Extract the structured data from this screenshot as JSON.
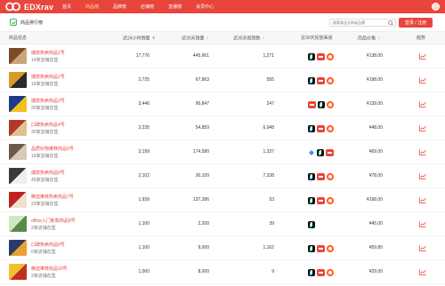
{
  "app": {
    "logo_text": "EDXrav",
    "nav": [
      "首页",
      "商品榜",
      "品牌榜",
      "店铺榜",
      "直播榜",
      "会员中心"
    ],
    "nav_active_index": 1
  },
  "subheader": {
    "title": "商品排行榜",
    "search_placeholder": "搜索商品名称或品牌",
    "cta_label": "登录 / 注册"
  },
  "table": {
    "columns": [
      {
        "label": "商品信息"
      },
      {
        "label": "近24小时销量",
        "sort": "▼"
      },
      {
        "label": "近30天销量",
        "sort": "⇕"
      },
      {
        "label": "近30天视频数",
        "sort": "⇕"
      },
      {
        "label": "近30天投放渠道"
      },
      {
        "label": "商品价格",
        "sort": "⇕"
      },
      {
        "label": "趋势"
      }
    ],
    "rows": [
      {
        "name": "爆款热卖商品1号",
        "shops": "14家店铺在售",
        "sales24": "17,776",
        "sales30": "445,961",
        "videos": "1,271",
        "platforms": [
          "dy",
          "tb",
          "ks"
        ],
        "price": "¥138.00",
        "thumb": [
          "#7a4a2a",
          "#c8a57a"
        ]
      },
      {
        "name": "爆款热卖商品2号",
        "shops": "16家店铺在售",
        "sales24": "2,725",
        "sales30": "67,863",
        "videos": "555",
        "platforms": [
          "dy",
          "tb",
          "ks"
        ],
        "price": "¥198.00",
        "thumb": [
          "#d89a2a",
          "#2a2a2a"
        ]
      },
      {
        "name": "爆款热卖商品3号",
        "shops": "20家店铺在售",
        "sales24": "3,446",
        "sales30": "90,847",
        "videos": "247",
        "platforms": [
          "tb",
          "dy",
          "ks"
        ],
        "price": "¥139.00",
        "thumb": [
          "#1c3a8a",
          "#f0c020"
        ]
      },
      {
        "name": "口碑热卖商品4号",
        "shops": "30家店铺在售",
        "sales24": "3,235",
        "sales30": "54,859",
        "videos": "6,948",
        "platforms": [
          "dy",
          "tb",
          "ks"
        ],
        "price": "¥48.00",
        "thumb": [
          "#b03a2a",
          "#e0c090"
        ]
      },
      {
        "name": "品质好物推荐商品5号",
        "shops": "16家店铺在售",
        "sales24": "3,199",
        "sales30": "174,580",
        "videos": "1,337",
        "platforms": [
          "pdd",
          "dy",
          "tb"
        ],
        "price": "¥69.00",
        "thumb": [
          "#6a5a4a",
          "#d8c8b8"
        ]
      },
      {
        "name": "爆款热卖商品6号",
        "shops": "45家店铺在售",
        "sales24": "2,102",
        "sales30": "30,109",
        "videos": "7,338",
        "platforms": [
          "dy",
          "tb",
          "ks"
        ],
        "price": "¥78.00",
        "thumb": [
          "#3a3a3a",
          "#eeeeee"
        ]
      },
      {
        "name": "精选推荐热卖商品7号",
        "shops": "23家店铺在售",
        "sales24": "1,939",
        "sales30": "137,286",
        "videos": "53",
        "platforms": [
          "dy",
          "tb",
          "ks"
        ],
        "price": "¥168.00",
        "thumb": [
          "#c02020",
          "#f0e0d0"
        ]
      },
      {
        "name": "office入门新款商品8号",
        "shops": "2家店铺在售",
        "sales24": "1,100",
        "sales30": "2,200",
        "videos": "39",
        "platforms": [
          "dy"
        ],
        "price": "¥45.00",
        "thumb": [
          "#d0e8c0",
          "#5a8a4a"
        ]
      },
      {
        "name": "口碑热卖商品9号",
        "shops": "6家店铺在售",
        "sales24": "1,100",
        "sales30": "9,000",
        "videos": "1,162",
        "platforms": [
          "dy",
          "tb",
          "ks"
        ],
        "price": "¥59.80",
        "thumb": [
          "#2a3a6a",
          "#e8a030"
        ]
      },
      {
        "name": "精选推荐商品10号",
        "shops": "2家店铺在售",
        "sales24": "1,000",
        "sales30": "8,000",
        "videos": "9",
        "platforms": [
          "dy",
          "tb",
          "ks"
        ],
        "price": "¥29.00",
        "thumb": [
          "#f0c030",
          "#c03020"
        ]
      }
    ]
  }
}
